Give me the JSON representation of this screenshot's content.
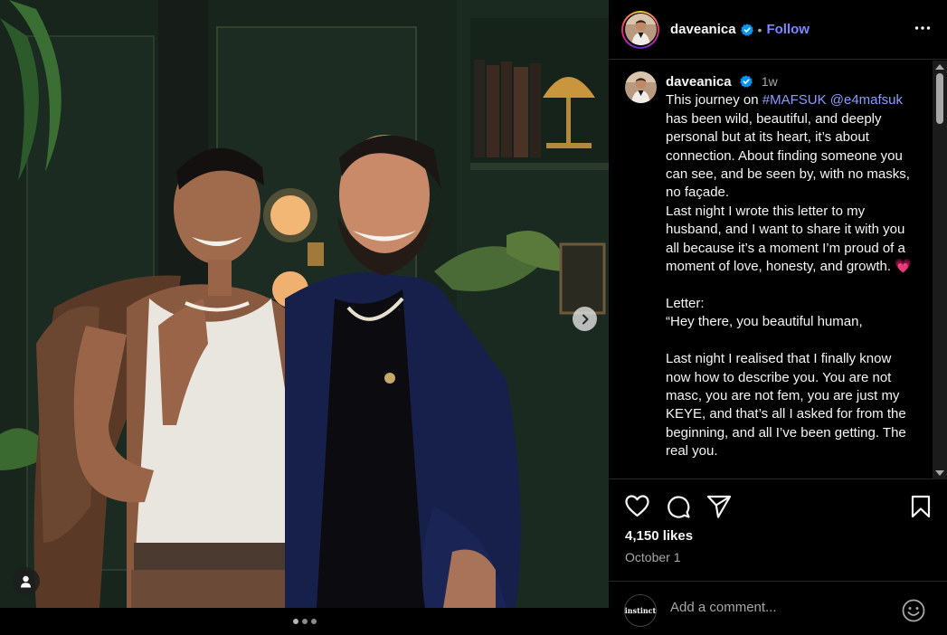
{
  "post": {
    "username": "daveanica",
    "separator": "•",
    "follow_label": "Follow",
    "time_ago": "1w",
    "caption_prefix": "This journey on ",
    "hashtag": "#MAFSUK",
    "mention": "@e4mafsuk",
    "caption_body": " has been wild, beautiful, and deeply personal but at its heart, it’s about connection. About finding someone you can see, and be seen by, with no masks, no façade.\nLast night I wrote this letter to my husband, and I want to share it with you all because it’s a moment I’m proud of a moment of love, honesty, and growth. 💗\n\nLetter:\n“Hey there, you beautiful human,\n\nLast night I realised that I finally know now how to describe you. You are not masc, you are not fem, you are just my KEYE, and that’s all I asked for from the beginning, and all I’ve been getting. The real you.",
    "likes": "4,150 likes",
    "date": "October 1"
  },
  "carousel": {
    "count": 3,
    "active_index": 0
  },
  "comment": {
    "placeholder": "Add a comment...",
    "avatar_text": "instinct"
  },
  "icons": {
    "verified": "verified-badge-icon",
    "more": "more-options-icon",
    "like": "heart-icon",
    "comment": "comment-icon",
    "share": "send-icon",
    "save": "bookmark-icon",
    "next": "chevron-right-icon",
    "tag": "user-tag-icon",
    "emoji": "emoji-icon"
  },
  "colors": {
    "background": "#000000",
    "link": "#8c9cff",
    "follow": "#7b88ff",
    "verified": "#0095f6",
    "muted": "#a8a8a8"
  }
}
